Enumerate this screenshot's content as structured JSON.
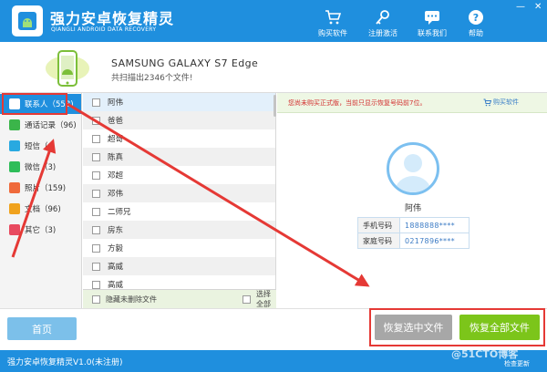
{
  "app": {
    "title": "强力安卓恢复精灵",
    "subtitle": "QIANGLI ANDROID DATA RECOVERY",
    "minimize": "—",
    "close": "✕"
  },
  "toolbar": [
    {
      "label": "购买软件",
      "icon": "cart-icon"
    },
    {
      "label": "注册激活",
      "icon": "key-icon"
    },
    {
      "label": "联系我们",
      "icon": "chat-icon"
    },
    {
      "label": "帮助",
      "icon": "help-icon"
    }
  ],
  "device": {
    "name": "SAMSUNG  GALAXY S7 Edge",
    "scan_result": "共扫描出2346个文件!"
  },
  "sidebar": [
    {
      "label": "联系人（558)",
      "color": "#4a8fd8",
      "active": true
    },
    {
      "label": "通话记录（96)",
      "color": "#3bb54a"
    },
    {
      "label": "短信（",
      "color": "#29a9e0"
    },
    {
      "label": "微信（3)",
      "color": "#2ebd59"
    },
    {
      "label": "照片（159)",
      "color": "#ef6a3b"
    },
    {
      "label": "文档（96)",
      "color": "#f0a21d"
    },
    {
      "label": "其它（3)",
      "color": "#e84a5f"
    }
  ],
  "contacts": [
    "阿伟",
    "爸爸",
    "超哥",
    "陈真",
    "邓超",
    "邓伟",
    "二师兄",
    "房东",
    "方毅",
    "高威",
    "高威"
  ],
  "list_footer": {
    "hide_deleted": "隐藏未删除文件",
    "select_all": "选择全部"
  },
  "notice": "您尚未购买正式版，当前只显示恢复号码前7位。",
  "buy_link": "购买软件",
  "detail": {
    "name": "阿伟",
    "fields": [
      {
        "key": "手机号码",
        "value": "1888888****"
      },
      {
        "key": "家庭号码",
        "value": "0217896****"
      }
    ]
  },
  "buttons": {
    "home": "首页",
    "recover_selected": "恢复选中文件",
    "recover_all": "恢复全部文件"
  },
  "status": {
    "text": "强力安卓恢复精灵V1.0(未注册)",
    "update": "检查更新",
    "watermark": "@51CTO博客"
  },
  "colors": {
    "brand": "#1f8fde",
    "recover_all": "#7cc51a",
    "annotation": "#e53935"
  }
}
